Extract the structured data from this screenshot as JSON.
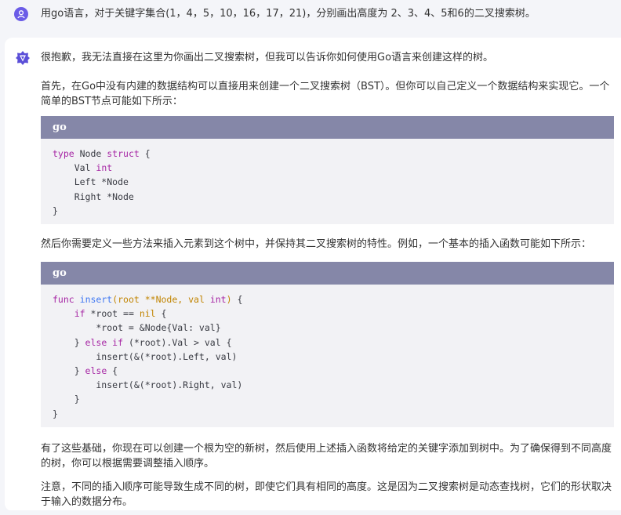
{
  "user_message": {
    "avatar_icon": "user-icon",
    "text": "用go语言，对于关键字集合(1，4，5，10，16，17，21)，分别画出高度为 2、3、4、5和6的二叉搜索树。"
  },
  "answer": {
    "logo_icon": "ai-assistant-logo-icon",
    "paragraphs": [
      "很抱歉，我无法直接在这里为你画出二叉搜索树，但我可以告诉你如何使用Go语言来创建这样的树。",
      "首先，在Go中没有内建的数据结构可以直接用来创建一个二叉搜索树（BST）。但你可以自己定义一个数据结构来实现它。一个简单的BST节点可能如下所示：",
      "然后你需要定义一些方法来插入元素到这个树中，并保持其二叉搜索树的特性。例如，一个基本的插入函数可能如下所示：",
      "有了这些基础，你现在可以创建一个根为空的新树，然后使用上述插入函数将给定的关键字添加到树中。为了确保得到不同高度的树，你可以根据需要调整插入顺序。",
      "注意，不同的插入顺序可能导致生成不同的树，即使它们具有相同的高度。这是因为二叉搜索树是动态查找树，它们的形状取决于输入的数据分布。"
    ],
    "code_blocks": [
      {
        "language": "go",
        "lines": [
          [
            {
              "t": "type",
              "c": "kw"
            },
            {
              "t": " Node ",
              "c": ""
            },
            {
              "t": "struct",
              "c": "kw"
            },
            {
              "t": " {",
              "c": ""
            }
          ],
          [
            {
              "t": "    Val ",
              "c": ""
            },
            {
              "t": "int",
              "c": "kw"
            }
          ],
          [
            {
              "t": "    Left *Node",
              "c": ""
            }
          ],
          [
            {
              "t": "    Right *Node",
              "c": ""
            }
          ],
          [
            {
              "t": "}",
              "c": ""
            }
          ]
        ]
      },
      {
        "language": "go",
        "lines": [
          [
            {
              "t": "func",
              "c": "kw"
            },
            {
              "t": " ",
              "c": ""
            },
            {
              "t": "insert",
              "c": "fn"
            },
            {
              "t": "(root **Node, val ",
              "c": "param"
            },
            {
              "t": "int",
              "c": "kw"
            },
            {
              "t": ")",
              "c": "param"
            },
            {
              "t": " {",
              "c": ""
            }
          ],
          [
            {
              "t": "    ",
              "c": ""
            },
            {
              "t": "if",
              "c": "kw"
            },
            {
              "t": " *root == ",
              "c": ""
            },
            {
              "t": "nil",
              "c": "lit"
            },
            {
              "t": " {",
              "c": ""
            }
          ],
          [
            {
              "t": "        *root = &Node{Val: val}",
              "c": ""
            }
          ],
          [
            {
              "t": "    } ",
              "c": ""
            },
            {
              "t": "else if",
              "c": "kw"
            },
            {
              "t": " (*root).Val > val {",
              "c": ""
            }
          ],
          [
            {
              "t": "        insert(&(*root).Left, val)",
              "c": ""
            }
          ],
          [
            {
              "t": "    } ",
              "c": ""
            },
            {
              "t": "else",
              "c": "kw"
            },
            {
              "t": " {",
              "c": ""
            }
          ],
          [
            {
              "t": "        insert(&(*root).Right, val)",
              "c": ""
            }
          ],
          [
            {
              "t": "    }",
              "c": ""
            }
          ],
          [
            {
              "t": "}",
              "c": ""
            }
          ]
        ]
      }
    ]
  },
  "colors": {
    "user_avatar": "#6b5ce7",
    "ai_logo": "#5b4fd8",
    "code_header": "#8587a8",
    "code_body": "#f2f2f5",
    "keyword": "#a626a4",
    "function": "#4078f2",
    "param": "#c18401"
  }
}
